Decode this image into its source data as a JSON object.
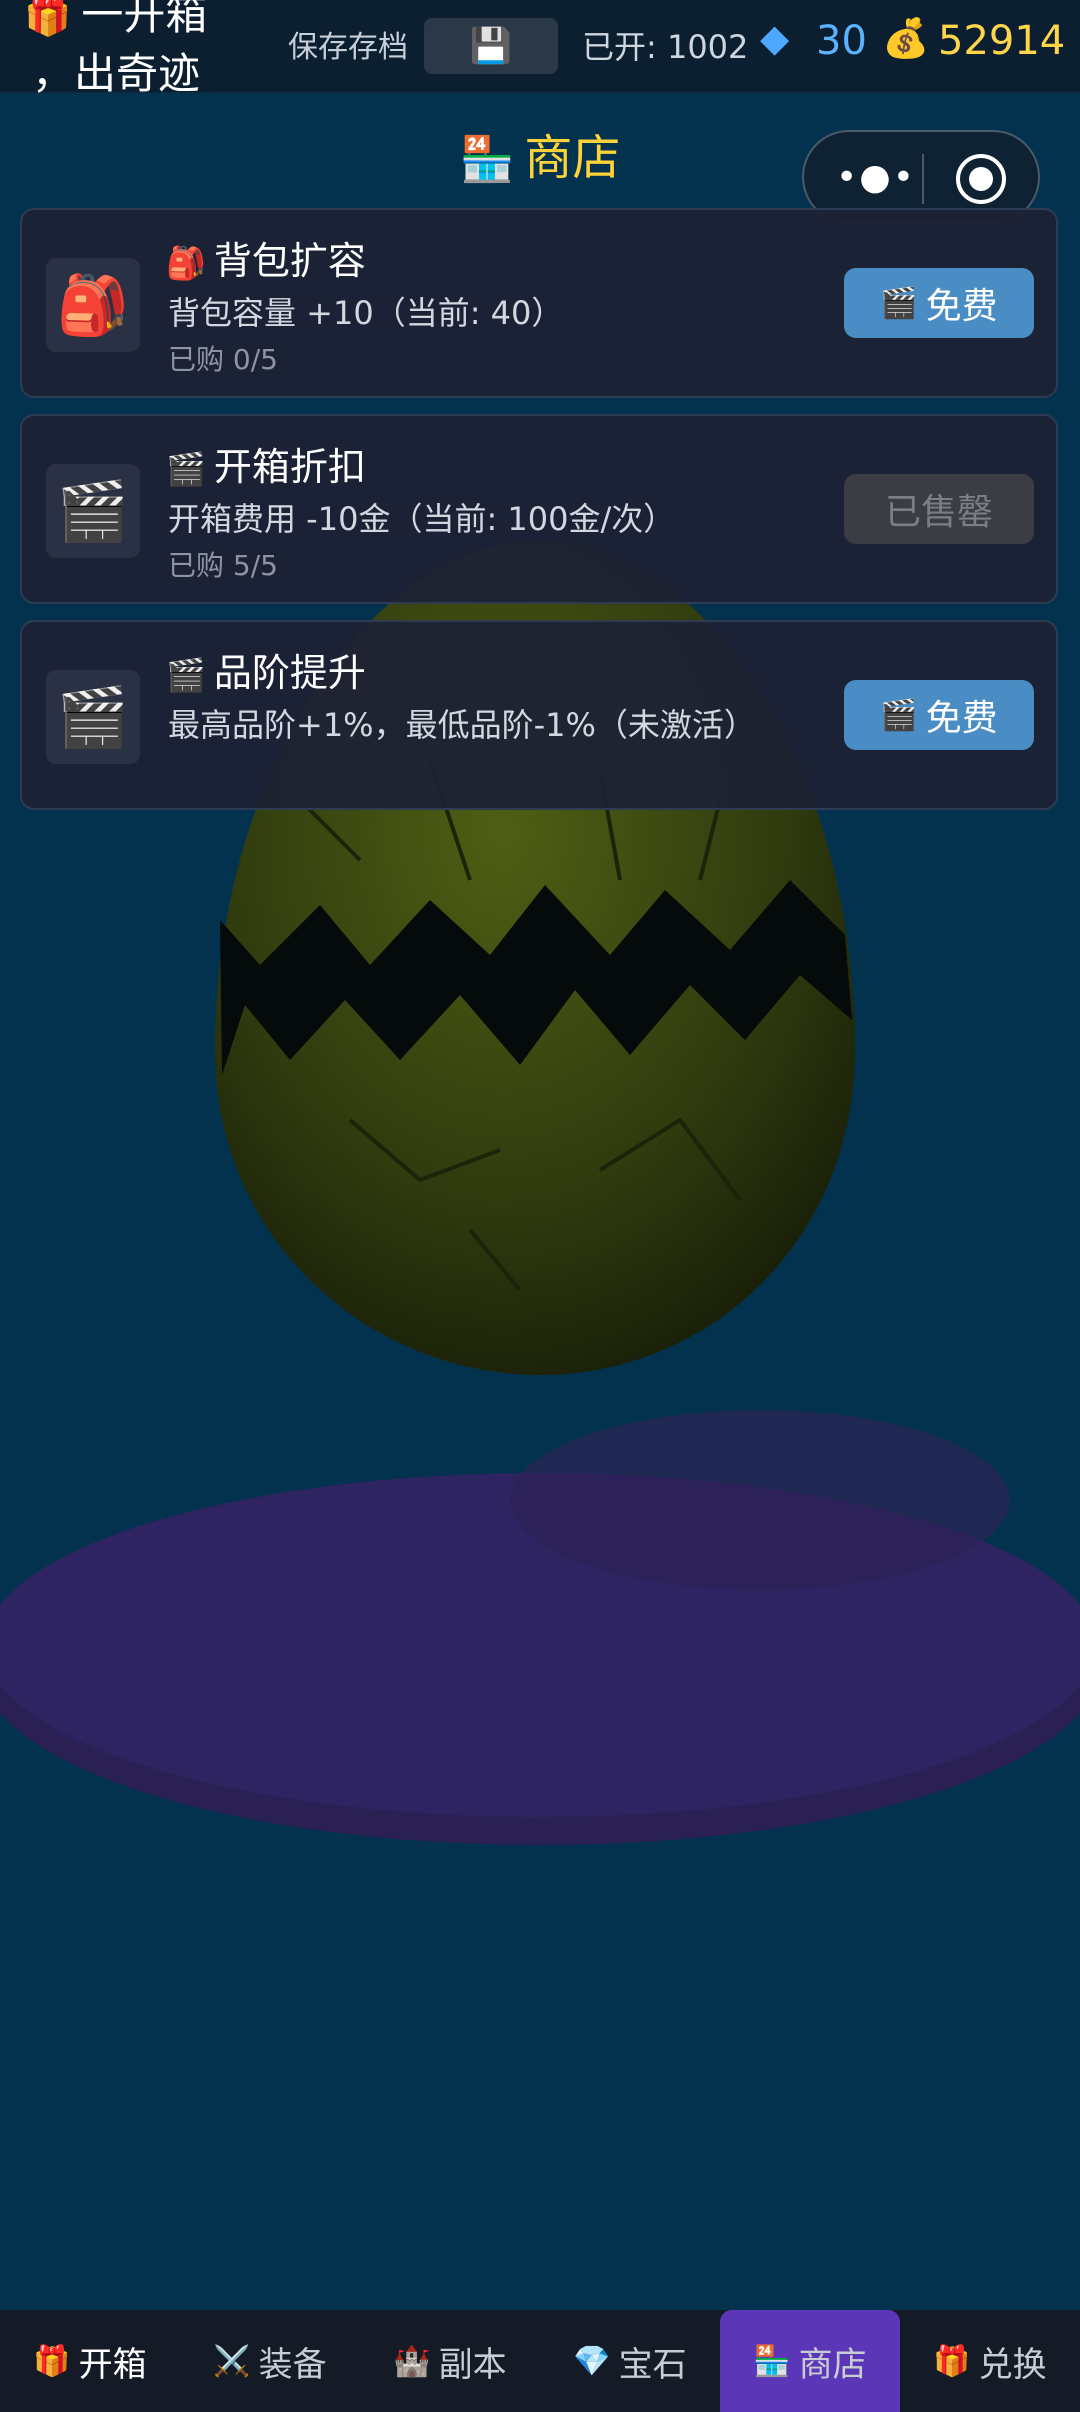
{
  "app": {
    "title_line1": "一开箱",
    "title_line2": "，出奇迹",
    "title_icon": "gift-icon"
  },
  "topbar": {
    "save_label": "保存存档",
    "save_icon": "floppy-disk-icon",
    "opened_text": "已开: 1002",
    "gems": "30",
    "gold": "52914"
  },
  "shop": {
    "title": "商店",
    "items": [
      {
        "name": "背包扩容",
        "description": "背包容量 +10（当前: 40）",
        "bought": "已购 0/5",
        "button": "免费",
        "icon": "backpack-icon"
      },
      {
        "name": "开箱折扣",
        "description": "开箱费用 -10金（当前: 100金/次）",
        "bought": "已购 5/5",
        "button": "已售罄",
        "icon": "clapperboard-icon"
      },
      {
        "name": "品阶提升",
        "description": "最高品阶+1%，最低品阶-1%（未激活）",
        "bought": "",
        "button": "免费",
        "icon": "clapperboard-icon"
      }
    ]
  },
  "tabs": [
    {
      "label": "开箱",
      "icon": "gift-icon"
    },
    {
      "label": "装备",
      "icon": "crossed-swords-icon"
    },
    {
      "label": "副本",
      "icon": "castle-icon"
    },
    {
      "label": "宝石",
      "icon": "gem-icon"
    },
    {
      "label": "商店",
      "icon": "store-icon",
      "active": true
    },
    {
      "label": "兑换",
      "icon": "gift-icon"
    }
  ],
  "colors": {
    "background": "#03324f",
    "accent_gold": "#ffd23a",
    "button_blue": "#4a8dc4",
    "active_tab": "#5b37b8"
  }
}
